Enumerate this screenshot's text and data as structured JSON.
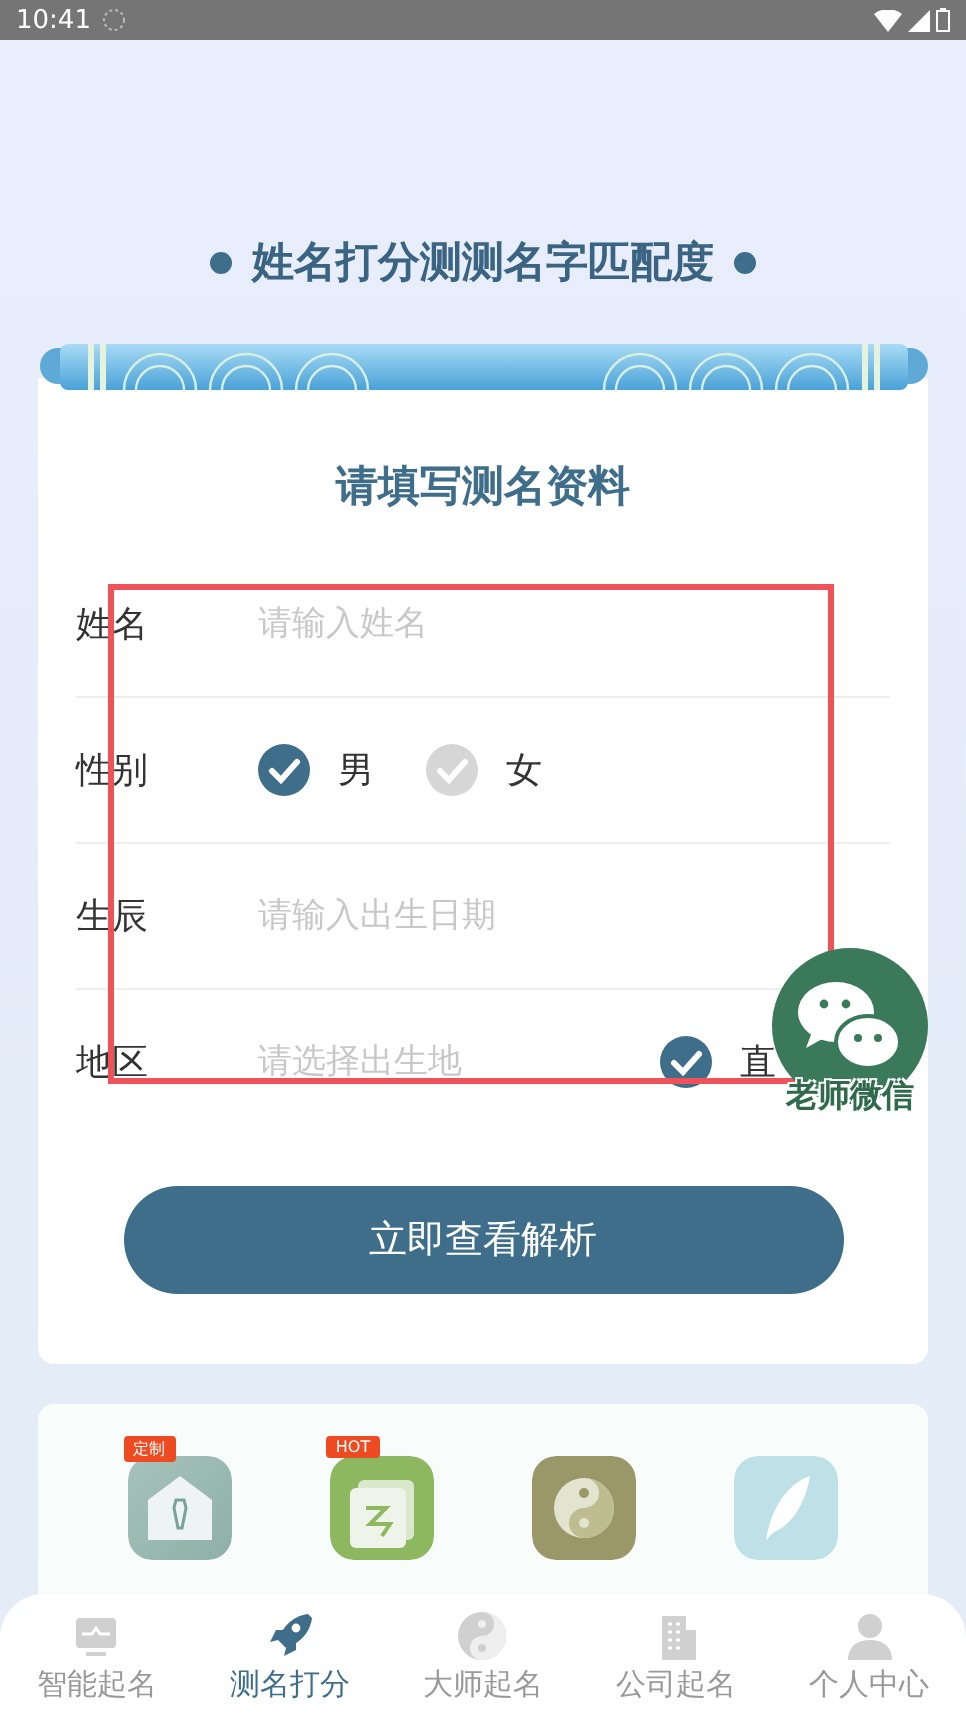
{
  "status_bar": {
    "time": "10:41"
  },
  "header": {
    "title": "姓名打分测测名字匹配度"
  },
  "form": {
    "title": "请填写测名资料",
    "fields": [
      {
        "kind": "text",
        "label": "姓名",
        "placeholder": "请输入姓名"
      },
      {
        "kind": "gender",
        "label": "性别",
        "options": [
          {
            "label": "男",
            "selected": true
          },
          {
            "label": "女",
            "selected": false
          }
        ]
      },
      {
        "kind": "text",
        "label": "生辰",
        "placeholder": "请输入出生日期"
      },
      {
        "kind": "location",
        "label": "地区",
        "placeholder": "请选择出生地",
        "option": {
          "label": "直",
          "checked": true
        }
      }
    ],
    "submit": "立即查看解析"
  },
  "float_button": {
    "label": "老师微信"
  },
  "features": [
    {
      "kind": "tie",
      "badge": "定制"
    },
    {
      "kind": "name",
      "badge": "HOT"
    },
    {
      "kind": "yinyang"
    },
    {
      "kind": "feather"
    }
  ],
  "nav": [
    {
      "label": "智能起名",
      "selected": false
    },
    {
      "label": "测名打分",
      "selected": true
    },
    {
      "label": "大师起名",
      "selected": false
    },
    {
      "label": "公司起名",
      "selected": false
    },
    {
      "label": "个人中心",
      "selected": false
    }
  ]
}
